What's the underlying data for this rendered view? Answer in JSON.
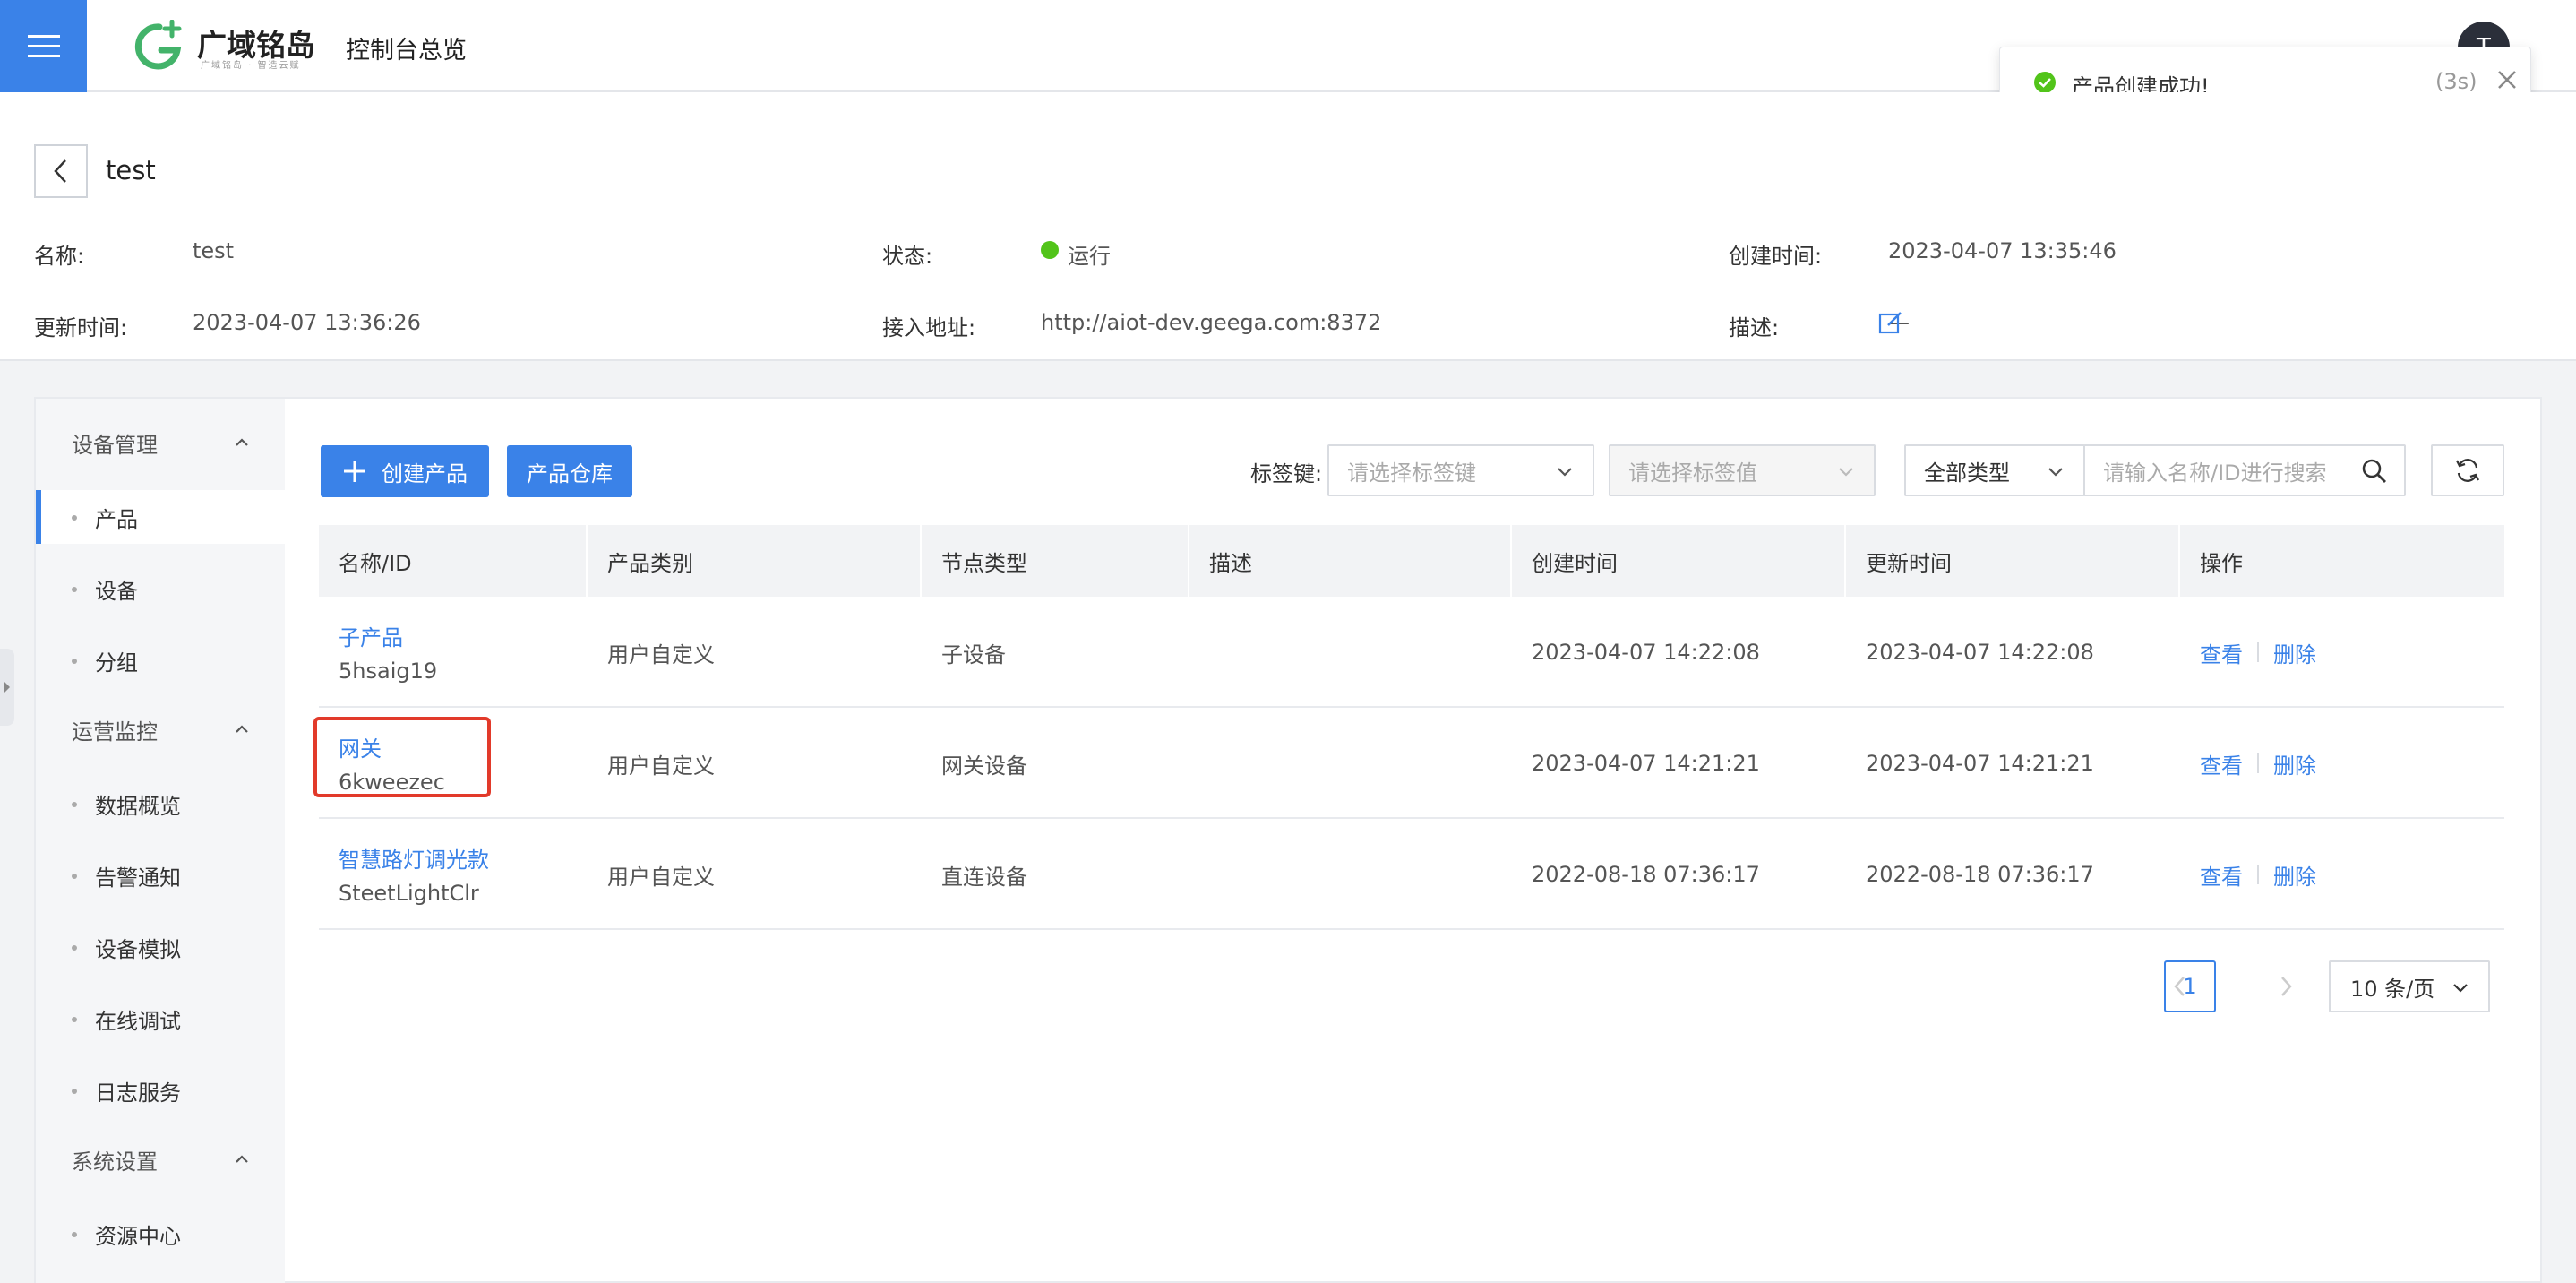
{
  "topbar": {
    "logo_text": "广域铭岛",
    "logo_sub": "广域铭岛 · 智造云赋",
    "app_title": "控制台总览",
    "avatar_initial": "T"
  },
  "toast": {
    "message": "产品创建成功!",
    "countdown": "(3s)"
  },
  "header": {
    "title": "test",
    "fields": {
      "name_label": "名称:",
      "name_value": "test",
      "status_label": "状态:",
      "status_value": "运行",
      "created_label": "创建时间:",
      "created_value": "2023-04-07 13:35:46",
      "updated_label": "更新时间:",
      "updated_value": "2023-04-07 13:36:26",
      "endpoint_label": "接入地址:",
      "endpoint_value": "http://aiot-dev.geega.com:8372",
      "desc_label": "描述:",
      "desc_value": "—"
    }
  },
  "sidebar": {
    "groups": [
      {
        "label": "设备管理",
        "items": [
          "产品",
          "设备",
          "分组"
        ]
      },
      {
        "label": "运营监控",
        "items": [
          "数据概览",
          "告警通知",
          "设备模拟",
          "在线调试",
          "日志服务"
        ]
      },
      {
        "label": "系统设置",
        "items": [
          "资源中心"
        ]
      }
    ],
    "active_item": "产品"
  },
  "toolbar": {
    "create_label": "创建产品",
    "warehouse_label": "产品仓库",
    "tag_key_label": "标签键:",
    "tag_key_placeholder": "请选择标签键",
    "tag_value_placeholder": "请选择标签值",
    "type_select": "全部类型",
    "search_placeholder": "请输入名称/ID进行搜索"
  },
  "table": {
    "headers": [
      "名称/ID",
      "产品类别",
      "节点类型",
      "描述",
      "创建时间",
      "更新时间",
      "操作"
    ],
    "rows": [
      {
        "name": "子产品",
        "id": "5hsaig19",
        "category": "用户自定义",
        "node_type": "子设备",
        "desc": "",
        "created": "2023-04-07 14:22:08",
        "updated": "2023-04-07 14:22:08"
      },
      {
        "name": "网关",
        "id": "6kweezec",
        "category": "用户自定义",
        "node_type": "网关设备",
        "desc": "",
        "created": "2023-04-07 14:21:21",
        "updated": "2023-04-07 14:21:21"
      },
      {
        "name": "智慧路灯调光款",
        "id": "SteetLightClr",
        "category": "用户自定义",
        "node_type": "直连设备",
        "desc": "",
        "created": "2022-08-18 07:36:17",
        "updated": "2022-08-18 07:36:17"
      }
    ],
    "action_view": "查看",
    "action_delete": "删除"
  },
  "pagination": {
    "current_page": "1",
    "page_size": "10 条/页"
  },
  "colors": {
    "primary": "#3a82e8",
    "success": "#52c41a",
    "highlight": "#e23a2a"
  }
}
